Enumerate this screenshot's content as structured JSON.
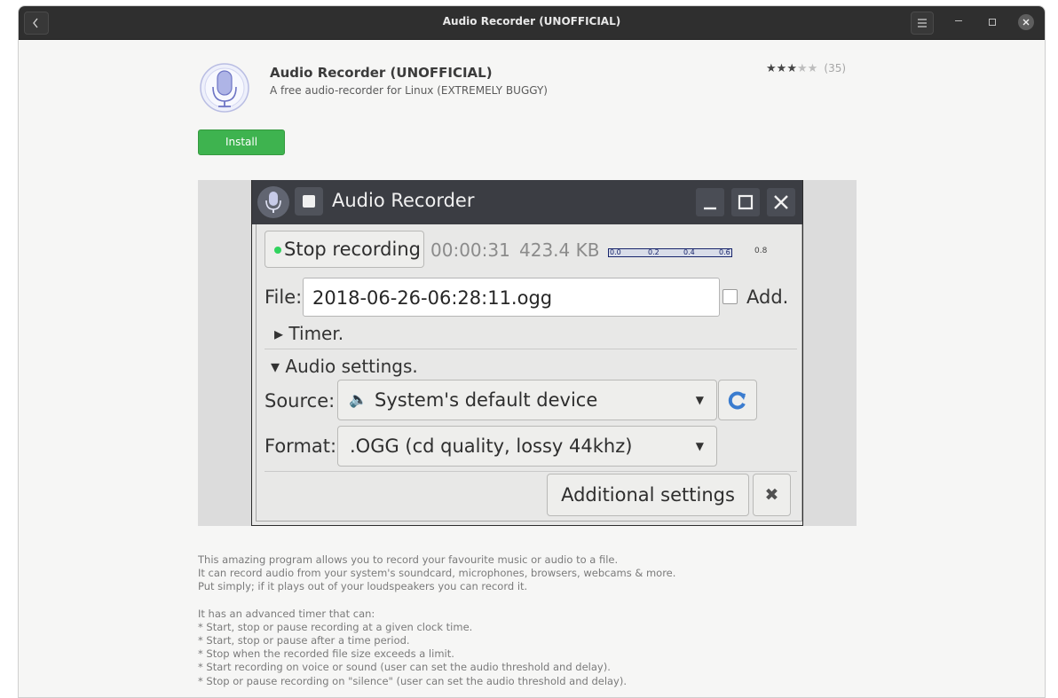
{
  "window": {
    "title": "Audio Recorder (UNOFFICIAL)",
    "back_icon": "chevron-left-icon",
    "menu_icon": "hamburger-menu-icon"
  },
  "app": {
    "name": "Audio Recorder (UNOFFICIAL)",
    "summary": "A free audio-recorder for Linux (EXTREMELY BUGGY)",
    "icon": "microphone-icon",
    "rating_stars": 3,
    "rating_max": 5,
    "rating_count": "(35)",
    "install_label": "Install",
    "install_color": "#3eb34f"
  },
  "screenshot": {
    "window_title": "Audio Recorder",
    "stop_button": "Stop recording",
    "elapsed": "00:00:31",
    "filesize": "423.4 KB",
    "meter_ticks": [
      "0.0",
      "0.2",
      "0.4",
      "0.6"
    ],
    "meter_end": "0.8",
    "file_label": "File:",
    "file_value": "2018-06-26-06:28:11.ogg",
    "add_label": "Add.",
    "timer_label": "Timer.",
    "audio_settings_label": "Audio settings.",
    "source_label": "Source:",
    "source_value": "System's default device",
    "format_label": "Format:",
    "format_value": ".OGG  (cd quality, lossy 44khz)",
    "additional_settings": "Additional settings",
    "close_glyph": "✖"
  },
  "description": {
    "para1": [
      "This amazing program allows you to record your favourite music or audio to a file.",
      "It can record audio from your system's soundcard, microphones, browsers, webcams & more.",
      "Put simply; if it plays out of your loudspeakers you can record it."
    ],
    "para2": [
      "It has an advanced timer that can:",
      "* Start, stop or pause recording at a given clock time.",
      "* Start, stop or pause after a time period.",
      "* Stop when the recorded file size exceeds a limit.",
      "* Start recording on voice or sound (user can set the audio threshold and delay).",
      "* Stop or pause recording on \"silence\" (user can set the audio threshold and delay)."
    ]
  }
}
